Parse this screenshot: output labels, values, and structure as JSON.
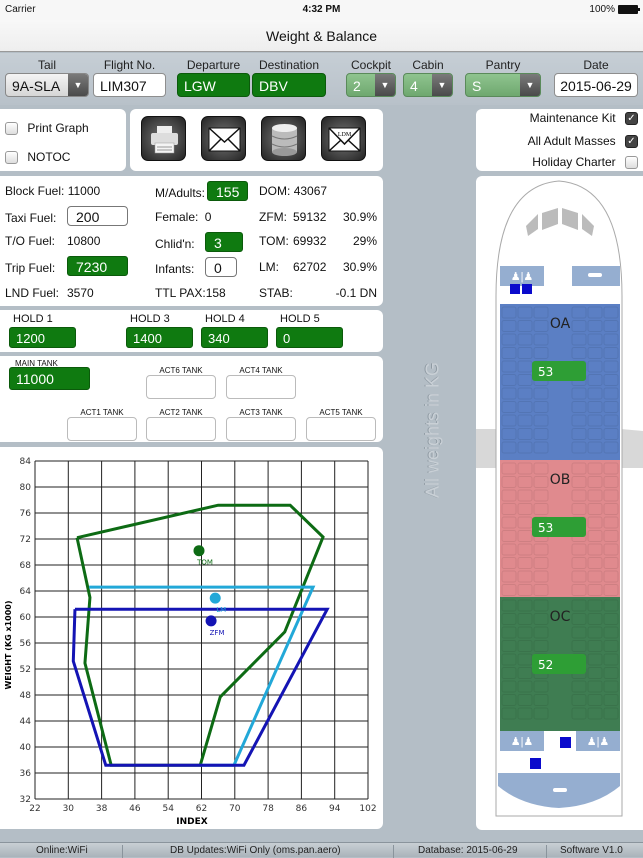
{
  "status_bar": {
    "carrier": "Carrier",
    "time": "4:32 PM",
    "battery": "100%"
  },
  "nav": {
    "title": "Weight & Balance"
  },
  "header_fields": {
    "tail": {
      "label": "Tail",
      "value": "9A-SLA"
    },
    "flight_no": {
      "label": "Flight No.",
      "value": "LIM307"
    },
    "departure": {
      "label": "Departure",
      "value": "LGW"
    },
    "destination": {
      "label": "Destination",
      "value": "DBV"
    },
    "cockpit": {
      "label": "Cockpit",
      "value": "2"
    },
    "cabin": {
      "label": "Cabin",
      "value": "4"
    },
    "pantry": {
      "label": "Pantry",
      "value": "S"
    },
    "date": {
      "label": "Date",
      "value": "2015-06-29"
    }
  },
  "options_left": [
    {
      "label": "Print Graph",
      "checked": false
    },
    {
      "label": "NOTOC",
      "checked": false
    }
  ],
  "action_buttons": [
    {
      "name": "print",
      "icon": "printer-icon"
    },
    {
      "name": "email",
      "icon": "envelope-icon"
    },
    {
      "name": "database",
      "icon": "database-icon"
    },
    {
      "name": "ldm",
      "icon": "ldm-envelope-icon",
      "label": "LDM"
    }
  ],
  "options_right": [
    {
      "label": "Maintenance Kit",
      "checked": true
    },
    {
      "label": "All Adult Masses",
      "checked": true
    },
    {
      "label": "Holiday Charter",
      "checked": false
    }
  ],
  "fuel": {
    "block": {
      "label": "Block Fuel:",
      "value": "11000"
    },
    "taxi": {
      "label": "Taxi Fuel:",
      "value": "200"
    },
    "to": {
      "label": "T/O Fuel:",
      "value": "10800"
    },
    "trip": {
      "label": "Trip Fuel:",
      "value": "7230"
    },
    "lnd": {
      "label": "LND Fuel:",
      "value": "3570"
    }
  },
  "pax": {
    "adults": {
      "label": "M/Adults:",
      "value": "155"
    },
    "female": {
      "label": "Female:",
      "value": "0"
    },
    "children": {
      "label": "Chlid'n:",
      "value": "3"
    },
    "infants": {
      "label": "Infants:",
      "value": "0"
    },
    "total": {
      "label": "TTL PAX:",
      "value": "158"
    }
  },
  "masses": {
    "dom": {
      "label": "DOM:",
      "value": "43067",
      "pct": ""
    },
    "zfm": {
      "label": "ZFM:",
      "value": "59132",
      "pct": "30.9%"
    },
    "tom": {
      "label": "TOM:",
      "value": "69932",
      "pct": "29%"
    },
    "lm": {
      "label": "LM:",
      "value": "62702",
      "pct": "30.9%"
    },
    "stab": {
      "label": "STAB:",
      "value": "-0.1 DN"
    }
  },
  "holds": [
    {
      "label": "HOLD 1",
      "value": "1200"
    },
    {
      "label": "HOLD 3",
      "value": "1400"
    },
    {
      "label": "HOLD 4",
      "value": "340"
    },
    {
      "label": "HOLD 5",
      "value": "0"
    }
  ],
  "tanks": {
    "main": {
      "label": "MAIN TANK",
      "value": "11000"
    },
    "act6": {
      "label": "ACT6 TANK",
      "value": ""
    },
    "act4": {
      "label": "ACT4 TANK",
      "value": ""
    },
    "act1": {
      "label": "ACT1 TANK",
      "value": ""
    },
    "act2": {
      "label": "ACT2 TANK",
      "value": ""
    },
    "act3": {
      "label": "ACT3 TANK",
      "value": ""
    },
    "act5": {
      "label": "ACT5 TANK",
      "value": ""
    }
  },
  "side_note": "All weights in KG",
  "cabin_zones": [
    {
      "name": "OA",
      "pax": "53",
      "color": "#5b7fc4"
    },
    {
      "name": "OB",
      "pax": "53",
      "color": "#e08a8e"
    },
    {
      "name": "OC",
      "pax": "52",
      "color": "#3f7d52"
    }
  ],
  "footer": {
    "online": "Online:WiFi",
    "db_updates": "DB Updates:WiFi Only   (oms.pan.aero)",
    "database": "Database: 2015-06-29",
    "software": "Software V1.0"
  },
  "colors": {
    "accent_green": "#0f7a10",
    "zfm": "#1414b4",
    "lm": "#22a8d8",
    "tom": "#0d6b14"
  },
  "chart_data": {
    "type": "line",
    "title": "",
    "xlabel": "INDEX",
    "ylabel": "WEIGHT (KG x1000)",
    "xlim": [
      22,
      102
    ],
    "ylim": [
      32,
      84
    ],
    "xticks": [
      22,
      30,
      38,
      46,
      54,
      62,
      70,
      78,
      86,
      94,
      102
    ],
    "yticks": [
      32,
      36,
      40,
      44,
      48,
      52,
      56,
      60,
      64,
      68,
      72,
      76,
      80,
      84
    ],
    "grid": true,
    "series": [
      {
        "name": "TOM envelope",
        "color": "#0d6b14",
        "points": [
          [
            32.1,
            72.2
          ],
          [
            66,
            77.2
          ],
          [
            83.3,
            77.2
          ],
          [
            91.2,
            72.3
          ],
          [
            82,
            57.7
          ],
          [
            66.5,
            47.7
          ],
          [
            61.7,
            37.2
          ],
          [
            40.3,
            37.2
          ],
          [
            34,
            52.9
          ],
          [
            35.2,
            63
          ],
          [
            32.1,
            72.2
          ]
        ]
      },
      {
        "name": "LM envelope",
        "color": "#22a8d8",
        "points": [
          [
            35,
            64.6
          ],
          [
            88.8,
            64.6
          ],
          [
            69.8,
            37.2
          ],
          [
            61.7,
            37.2
          ]
        ]
      },
      {
        "name": "ZFM envelope",
        "color": "#1414b4",
        "points": [
          [
            31.6,
            61.2
          ],
          [
            92.2,
            61.2
          ],
          [
            72.2,
            37.2
          ],
          [
            39,
            37.2
          ],
          [
            31.2,
            53.2
          ],
          [
            31.6,
            61.2
          ]
        ]
      }
    ],
    "markers": [
      {
        "label": "TOM",
        "x": 61.4,
        "y": 70.2,
        "color": "#0d6b14"
      },
      {
        "label": "LM",
        "x": 65.3,
        "y": 62.9,
        "color": "#22a8d8"
      },
      {
        "label": "ZFM",
        "x": 64.3,
        "y": 59.4,
        "color": "#1414b4"
      }
    ]
  }
}
